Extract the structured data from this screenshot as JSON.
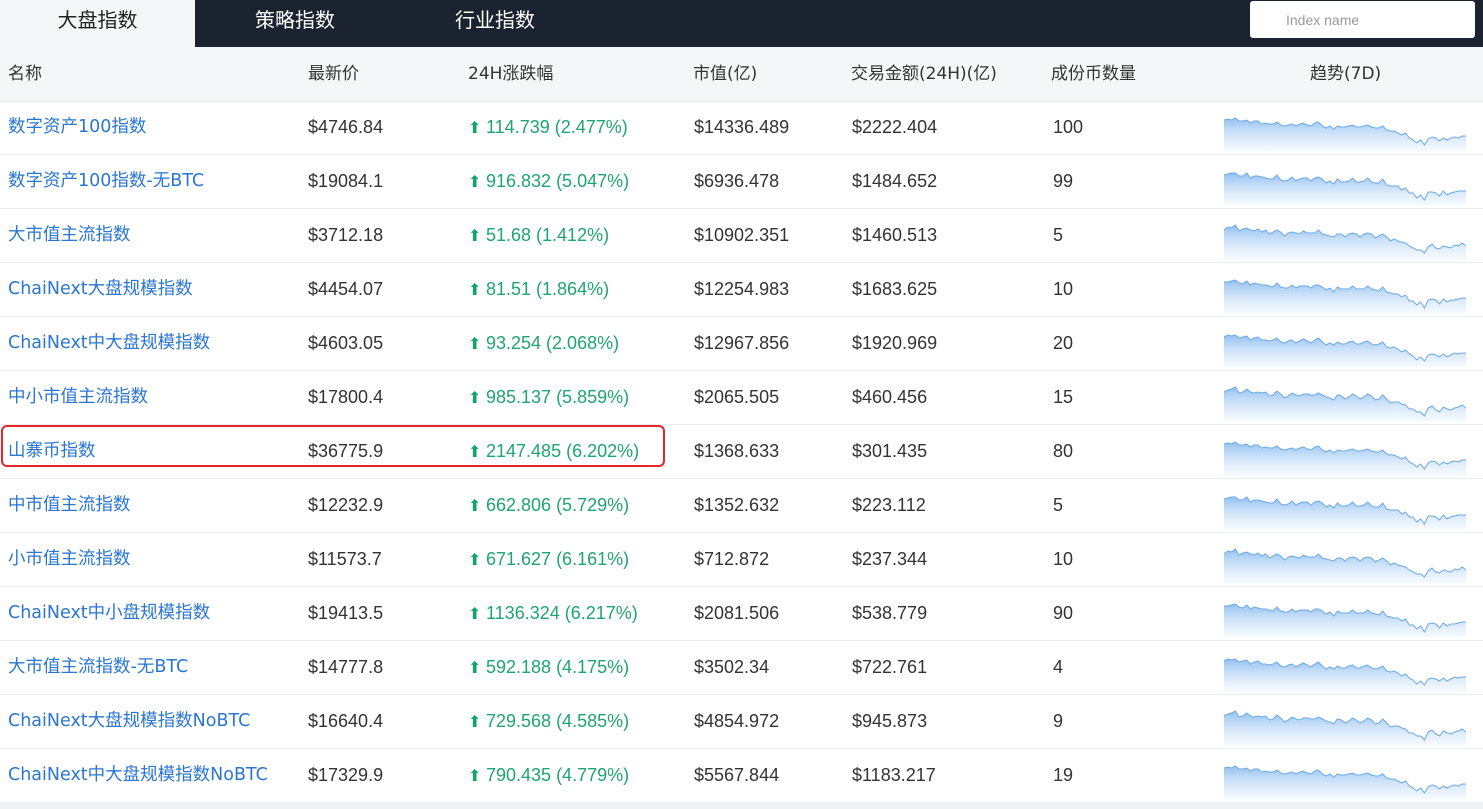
{
  "tabs": [
    {
      "label": "大盘指数",
      "active": true
    },
    {
      "label": "策略指数",
      "active": false
    },
    {
      "label": "行业指数",
      "active": false
    }
  ],
  "search": {
    "placeholder": "Index name"
  },
  "columns": [
    "名称",
    "最新价",
    "24H涨跌幅",
    "市值(亿)",
    "交易金额(24H)(亿)",
    "成份币数量",
    "趋势(7D)"
  ],
  "rows": [
    {
      "name": "数字资产100指数",
      "price": "$4746.84",
      "change": "114.739 (2.477%)",
      "market_cap": "$14336.489",
      "volume": "$2222.404",
      "count": "100"
    },
    {
      "name": "数字资产100指数-无BTC",
      "price": "$19084.1",
      "change": "916.832 (5.047%)",
      "market_cap": "$6936.478",
      "volume": "$1484.652",
      "count": "99"
    },
    {
      "name": "大市值主流指数",
      "price": "$3712.18",
      "change": "51.68 (1.412%)",
      "market_cap": "$10902.351",
      "volume": "$1460.513",
      "count": "5"
    },
    {
      "name": "ChaiNext大盘规模指数",
      "price": "$4454.07",
      "change": "81.51 (1.864%)",
      "market_cap": "$12254.983",
      "volume": "$1683.625",
      "count": "10"
    },
    {
      "name": "ChaiNext中大盘规模指数",
      "price": "$4603.05",
      "change": "93.254 (2.068%)",
      "market_cap": "$12967.856",
      "volume": "$1920.969",
      "count": "20"
    },
    {
      "name": "中小市值主流指数",
      "price": "$17800.4",
      "change": "985.137 (5.859%)",
      "market_cap": "$2065.505",
      "volume": "$460.456",
      "count": "15"
    },
    {
      "name": "山寨币指数",
      "price": "$36775.9",
      "change": "2147.485 (6.202%)",
      "market_cap": "$1368.633",
      "volume": "$301.435",
      "count": "80"
    },
    {
      "name": "中市值主流指数",
      "price": "$12232.9",
      "change": "662.806 (5.729%)",
      "market_cap": "$1352.632",
      "volume": "$223.112",
      "count": "5"
    },
    {
      "name": "小市值主流指数",
      "price": "$11573.7",
      "change": "671.627 (6.161%)",
      "market_cap": "$712.872",
      "volume": "$237.344",
      "count": "10"
    },
    {
      "name": "ChaiNext中小盘规模指数",
      "price": "$19413.5",
      "change": "1136.324 (6.217%)",
      "market_cap": "$2081.506",
      "volume": "$538.779",
      "count": "90"
    },
    {
      "name": "大市值主流指数-无BTC",
      "price": "$14777.8",
      "change": "592.188 (4.175%)",
      "market_cap": "$3502.34",
      "volume": "$722.761",
      "count": "4"
    },
    {
      "name": "ChaiNext大盘规模指数NoBTC",
      "price": "$16640.4",
      "change": "729.568 (4.585%)",
      "market_cap": "$4854.972",
      "volume": "$945.873",
      "count": "9"
    },
    {
      "name": "ChaiNext中大盘规模指数NoBTC",
      "price": "$17329.9",
      "change": "790.435 (4.779%)",
      "market_cap": "$5567.844",
      "volume": "$1183.217",
      "count": "19"
    }
  ],
  "highlighted_row": 6,
  "icons": {
    "change_arrow": "up-arrow-icon",
    "trend": "sparkline-chart"
  },
  "colors": {
    "topbar": "#1b2330",
    "link": "#2a76d2",
    "up": "#1fa474",
    "highlight": "#e8252b",
    "sparkline": "#8cbdf0"
  }
}
